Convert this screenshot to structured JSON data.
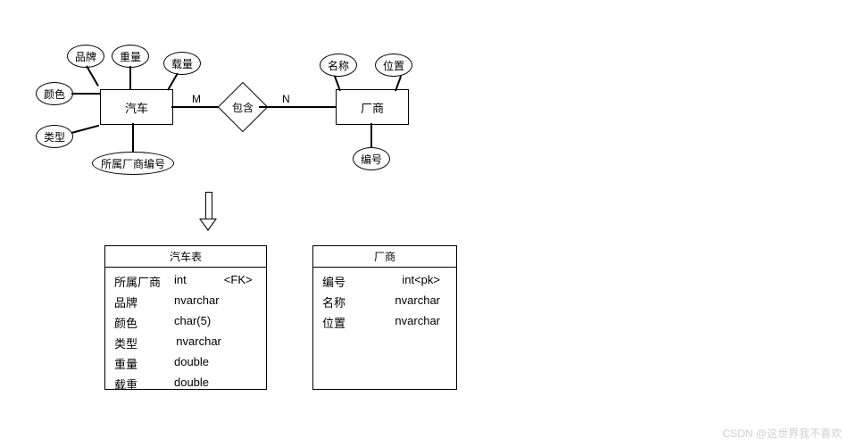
{
  "er": {
    "car": {
      "label": "汽车",
      "attrs": {
        "brand": "品牌",
        "weight": "重量",
        "load": "载量",
        "color": "颜色",
        "type": "类型",
        "mfr_id": "所属厂商编号"
      }
    },
    "mfr": {
      "label": "厂商",
      "attrs": {
        "name": "名称",
        "location": "位置",
        "id": "编号"
      }
    },
    "rel": {
      "label": "包含",
      "left_card": "M",
      "right_card": "N"
    }
  },
  "tables": {
    "car": {
      "title": "汽车表",
      "rows": [
        {
          "name": "所属厂商",
          "type": "int",
          "tag": "<FK>"
        },
        {
          "name": "品牌",
          "type": "nvarchar",
          "tag": ""
        },
        {
          "name": "颜色",
          "type": "char(5)",
          "tag": ""
        },
        {
          "name": "类型",
          "type": "nvarchar",
          "tag": ""
        },
        {
          "name": "重量",
          "type": "double",
          "tag": ""
        },
        {
          "name": "载重",
          "type": "double",
          "tag": ""
        }
      ]
    },
    "mfr": {
      "title": "厂商",
      "rows": [
        {
          "name": "编号",
          "type": "int<pk>",
          "tag": ""
        },
        {
          "name": "名称",
          "type": "nvarchar",
          "tag": ""
        },
        {
          "name": "位置",
          "type": "nvarchar",
          "tag": ""
        }
      ]
    }
  },
  "watermark": "CSDN @这世界我不喜欢"
}
